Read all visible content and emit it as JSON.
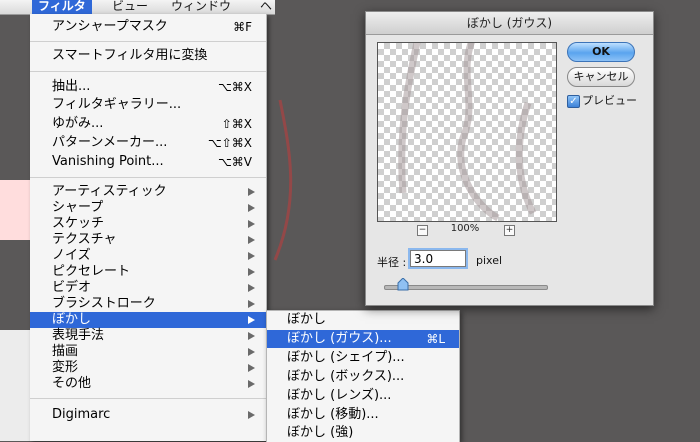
{
  "menubar": {
    "filter": "フィルタ",
    "view": "ビュー",
    "window": "ウィンドウ",
    "help": "ヘ"
  },
  "filter_menu": {
    "last_filter": {
      "label": "アンシャープマスク",
      "shortcut": "⌘F"
    },
    "smart_filter": "スマートフィルタ用に変換",
    "extract": {
      "label": "抽出...",
      "shortcut": "⌥⌘X"
    },
    "gallery": "フィルタギャラリー...",
    "liquify": {
      "label": "ゆがみ...",
      "shortcut": "⇧⌘X"
    },
    "pattern_maker": {
      "label": "パターンメーカー...",
      "shortcut": "⌥⇧⌘X"
    },
    "vanishing_point": {
      "label": "Vanishing Point...",
      "shortcut": "⌥⌘V"
    },
    "submenus": [
      "アーティスティック",
      "シャープ",
      "スケッチ",
      "テクスチャ",
      "ノイズ",
      "ピクセレート",
      "ビデオ",
      "ブラシストローク",
      "ぼかし",
      "表現手法",
      "描画",
      "変形",
      "その他"
    ],
    "digimarc": "Digimarc"
  },
  "blur_menu": {
    "items": [
      {
        "label": "ぼかし",
        "shortcut": ""
      },
      {
        "label": "ぼかし (ガウス)...",
        "shortcut": "⌘L"
      },
      {
        "label": "ぼかし (シェイプ)...",
        "shortcut": ""
      },
      {
        "label": "ぼかし (ボックス)...",
        "shortcut": ""
      },
      {
        "label": "ぼかし (レンズ)...",
        "shortcut": ""
      },
      {
        "label": "ぼかし (移動)...",
        "shortcut": ""
      },
      {
        "label": "ぼかし (強)",
        "shortcut": ""
      }
    ]
  },
  "dialog": {
    "title": "ぼかし (ガウス)",
    "ok": "OK",
    "cancel": "キャンセル",
    "preview_label": "プレビュー",
    "preview_checked": true,
    "zoom_out": "−",
    "zoom_in": "+",
    "zoom_level": "100%",
    "radius_label": "半径 :",
    "radius_value": "3.0",
    "radius_unit": "pixel",
    "radius_slider_fraction": 0.12
  },
  "colors": {
    "highlight": "#2f68d8",
    "desktop": "#5a5858",
    "ok_button": "#5aa4ee",
    "canvas_accent": "#ff2a2a"
  },
  "icons": [
    "submenu-arrow-icon",
    "checkmark-icon",
    "slider-thumb-icon",
    "zoom-in-icon",
    "zoom-out-icon"
  ]
}
